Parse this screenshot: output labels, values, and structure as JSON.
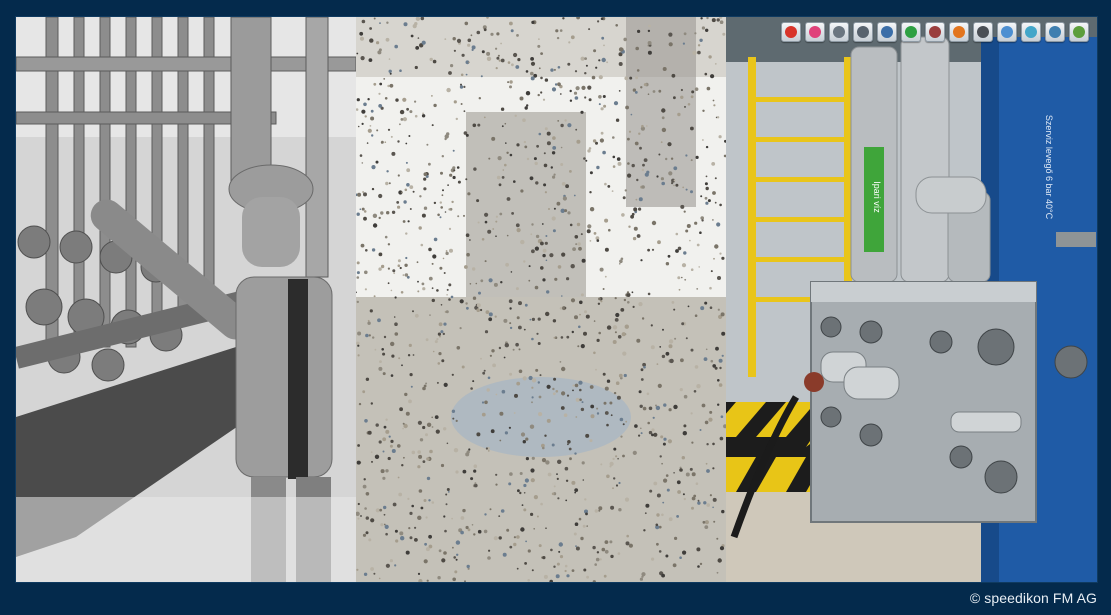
{
  "toolbar": {
    "buttons": [
      {
        "icon": "location-pin-icon",
        "color": "#d8342a"
      },
      {
        "icon": "multi-marker-icon",
        "color": "#e0417a"
      },
      {
        "icon": "split-view-icon",
        "color": "#6b7680"
      },
      {
        "icon": "zoom-search-icon",
        "color": "#58636e"
      },
      {
        "icon": "network-nodes-icon",
        "color": "#3b6ea8"
      },
      {
        "icon": "layers-green-icon",
        "color": "#2ea043"
      },
      {
        "icon": "measure-tool-icon",
        "color": "#9a3d3d"
      },
      {
        "icon": "avatar-person-icon",
        "color": "#e2751e"
      },
      {
        "icon": "slope-tool-icon",
        "color": "#4a4f55"
      },
      {
        "icon": "panorama-window-icon",
        "color": "#4d8fd1"
      },
      {
        "icon": "landscape-image-icon",
        "color": "#43a6c9"
      },
      {
        "icon": "camera-view-icon",
        "color": "#3f7fb0"
      },
      {
        "icon": "edit-pencil-icon",
        "color": "#5c9e3b"
      }
    ]
  },
  "panels": {
    "cad": {
      "label": "cad-model-view"
    },
    "cloud": {
      "label": "point-cloud-view"
    },
    "photo": {
      "label": "photo-view"
    }
  },
  "pipe_labels": {
    "green_tag": "Ipari víz",
    "blue_tag": "Szerviz levegő 6 bar 40°C"
  },
  "footer": {
    "copyright": "© speedikon FM AG"
  }
}
